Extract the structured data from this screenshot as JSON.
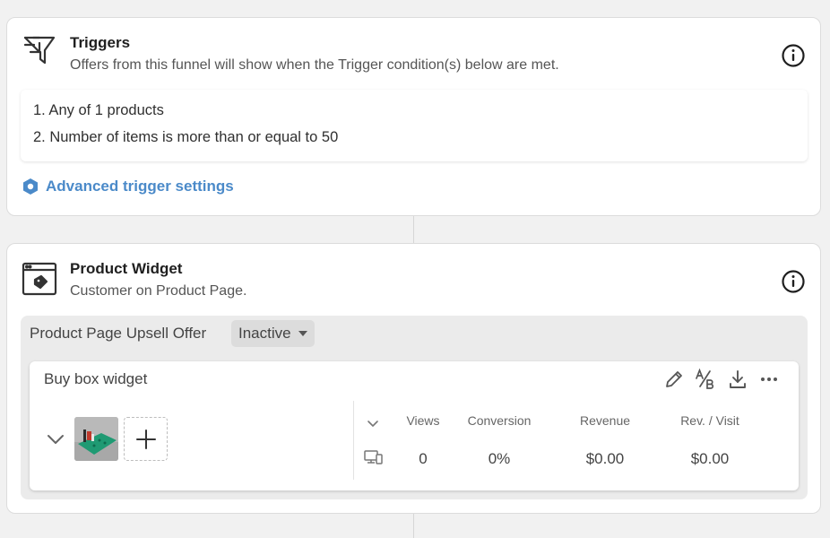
{
  "triggers": {
    "title": "Triggers",
    "subtitle": "Offers from this funnel will show when the Trigger condition(s) below are met.",
    "conditions": [
      "1. Any of 1 products",
      "2. Number of items is more than or equal to 50"
    ],
    "advanced_link": "Advanced trigger settings"
  },
  "product_widget": {
    "title": "Product Widget",
    "subtitle": "Customer on Product Page.",
    "offer": {
      "name": "Product Page Upsell Offer",
      "status": "Inactive"
    },
    "widget": {
      "name": "Buy box widget",
      "stats": {
        "headers": [
          "Views",
          "Conversion",
          "Revenue",
          "Rev. / Visit"
        ],
        "values": [
          "0",
          "0%",
          "$0.00",
          "$0.00"
        ]
      }
    }
  },
  "colors": {
    "accent_link": "#4b8ac9",
    "page_bg": "#f1f1f1",
    "offer_panel_bg": "#ebebeb",
    "thumb_green": "#1f9a73"
  }
}
